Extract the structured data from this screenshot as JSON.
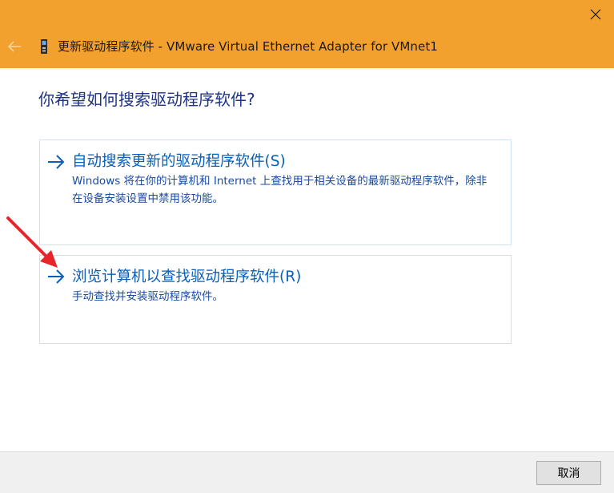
{
  "window": {
    "title_prefix": "更新驱动程序软件 - VMware Virtual Ethernet Adapter for VMnet1",
    "accent_color": "#f2a02e"
  },
  "icons": {
    "close": "close-icon",
    "back": "back-arrow-icon",
    "device": "network-adapter-icon",
    "option_arrow": "right-arrow-icon",
    "annotation": "red-pointer-arrow"
  },
  "main": {
    "heading": "你希望如何搜索驱动程序软件?"
  },
  "options": [
    {
      "title": "自动搜索更新的驱动程序软件(S)",
      "description": "Windows 将在你的计算机和 Internet 上查找用于相关设备的最新驱动程序软件，除非在设备安装设置中禁用该功能。"
    },
    {
      "title": "浏览计算机以查找驱动程序软件(R)",
      "description": "手动查找并安装驱动程序软件。"
    }
  ],
  "footer": {
    "cancel_label": "取消"
  }
}
